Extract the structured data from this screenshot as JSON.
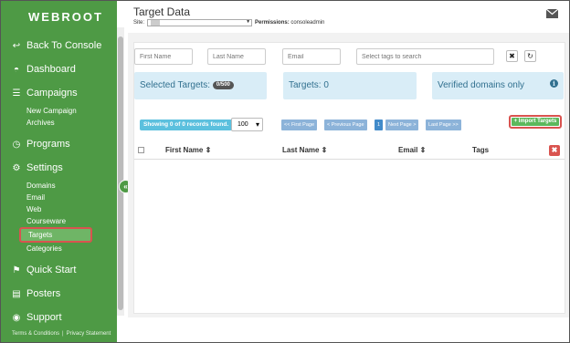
{
  "sidebar": {
    "logo": "WEBROOT",
    "nav": [
      {
        "icon": "↩",
        "label": "Back To Console"
      },
      {
        "icon": "◓",
        "label": "Dashboard"
      },
      {
        "icon": "☰",
        "label": "Campaigns"
      },
      {
        "icon": "◷",
        "label": "Programs"
      },
      {
        "icon": "⚙",
        "label": "Settings"
      },
      {
        "icon": "⚑",
        "label": "Quick Start"
      },
      {
        "icon": "▤",
        "label": "Posters"
      },
      {
        "icon": "◉",
        "label": "Support"
      }
    ],
    "campaigns_sub": [
      "New Campaign",
      "Archives"
    ],
    "settings_sub": [
      "Domains",
      "Email",
      "Web",
      "Courseware",
      "Targets",
      "Categories"
    ],
    "footer": {
      "terms": "Terms & Conditions",
      "sep": "|",
      "privacy": "Privacy Statement"
    },
    "collapse": "«"
  },
  "header": {
    "title": "Target Data",
    "site_label": "Site:",
    "permissions_label": "Permissions:",
    "permissions_value": "consoleadmin"
  },
  "filters": {
    "first_name_placeholder": "First Name",
    "last_name_placeholder": "Last Name",
    "email_placeholder": "Email",
    "tags_placeholder": "Select tags to search",
    "clear": "✖",
    "refresh": "↻"
  },
  "summary": {
    "selected_label": "Selected Targets:",
    "selected_badge": "0/500",
    "targets_label": "Targets: 0",
    "verified_label": "Verified domains only",
    "info": "i"
  },
  "pager": {
    "showing": "Showing 0 of 0 records found.",
    "per_page": "100",
    "first": "<< First Page",
    "previous": "< Previous Page",
    "page": "1",
    "next": "Next Page >",
    "last": "Last Page >>"
  },
  "import_button": "+ Import Targets",
  "table": {
    "columns": [
      "First Name ⇕",
      "Last Name ⇕",
      "Email ⇕",
      "Tags"
    ],
    "delete": "✖"
  }
}
